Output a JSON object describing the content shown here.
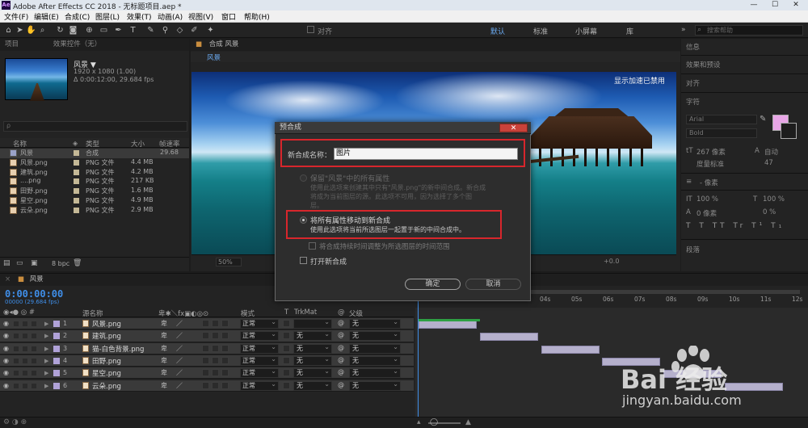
{
  "titlebar": {
    "logo": "Ae",
    "title": "Adobe After Effects CC 2018 - 无标题项目.aep *",
    "minimize": "—",
    "maximize": "☐",
    "close": "✕"
  },
  "menu": [
    "文件(F)",
    "编辑(E)",
    "合成(C)",
    "图层(L)",
    "效果(T)",
    "动画(A)",
    "视图(V)",
    "窗口",
    "帮助(H)"
  ],
  "toolbar": {
    "snap_label": "对齐",
    "workspaces": [
      "默认",
      "标准",
      "小屏幕",
      "库"
    ],
    "search_placeholder": "搜索帮助"
  },
  "project": {
    "tabs": [
      "项目",
      "效果控件（无）"
    ],
    "selected_name": "风景 ▼",
    "selected_info1": "1920 x 1080 (1.00)",
    "selected_info2": "Δ 0:00:12:00, 29.684 fps",
    "search_placeholder": "ρ",
    "columns": [
      "名称",
      "类型",
      "大小",
      "帧速率"
    ],
    "items": [
      {
        "name": "风景",
        "type": "合成",
        "size": "",
        "fps": "29.68",
        "comp": true
      },
      {
        "name": "风景.png",
        "type": "PNG 文件",
        "size": "4.4 MB",
        "fps": ""
      },
      {
        "name": "建筑.png",
        "type": "PNG 文件",
        "size": "4.2 MB",
        "fps": ""
      },
      {
        "name": "....png",
        "type": "PNG 文件",
        "size": "217 KB",
        "fps": ""
      },
      {
        "name": "田野.png",
        "type": "PNG 文件",
        "size": "1.6 MB",
        "fps": ""
      },
      {
        "name": "星空.png",
        "type": "PNG 文件",
        "size": "4.9 MB",
        "fps": ""
      },
      {
        "name": "云朵.png",
        "type": "PNG 文件",
        "size": "2.9 MB",
        "fps": ""
      }
    ],
    "bpc": "8 bpc"
  },
  "viewer": {
    "tab": "合成 风景",
    "subtab": "风景",
    "gpu_message": "显示加速已禁用",
    "zoom": "50%",
    "offset": "+0.0"
  },
  "right_panel": {
    "sections": [
      "信息",
      "效果和预设",
      "对齐",
      "字符"
    ],
    "font": "Arial",
    "style": "Bold",
    "size1": "267 像素",
    "auto": "自动",
    "metrics": "度量标准",
    "tracking": "47",
    "px": "- 像素",
    "scale_v": "100 %",
    "scale_h": "100 %",
    "baseline": "0 像素",
    "tsume": "0 %",
    "paragraph": "段落",
    "fill_color": "#e8a6e6"
  },
  "dialog": {
    "title": "预合成",
    "close": "✕",
    "name_label": "新合成名称：",
    "name_value": "图片",
    "opt1_title": "保留\"风景\"中的所有属性",
    "opt1_desc1": "使用此选项来创建其中只有\"风景.png\"的新中间合成。新合成",
    "opt1_desc2": "将成为当前图层的源。此选项不可用，因为选择了多个图",
    "opt1_desc3": "层。",
    "opt2_title": "将所有属性移动到新合成",
    "opt2_desc": "使用此选项将当前所选图层一起置于新的中间合成中。",
    "adjust_label": "将合成持续时间调整为所选图层的时间范围",
    "open_label": "打开新合成",
    "ok": "确定",
    "cancel": "取消"
  },
  "timeline": {
    "tab": "风景",
    "timecode": "0:00:00:00",
    "timecode_sub": "00000 (29.684 fps)",
    "col_name": "源名称",
    "col_mode": "模式",
    "col_t": "T",
    "col_trk": "TrkMat",
    "col_parent": "父级",
    "ticks": [
      "04s",
      "05s",
      "06s",
      "07s",
      "08s",
      "09s",
      "10s",
      "11s",
      "12s"
    ],
    "layers": [
      {
        "num": "1",
        "name": "风景.png",
        "mode": "正常",
        "trk": "",
        "parent": "无",
        "start": 0.0,
        "end": 0.154
      },
      {
        "num": "2",
        "name": "建筑.png",
        "mode": "正常",
        "trk": "无",
        "parent": "无",
        "start": 0.162,
        "end": 0.315
      },
      {
        "num": "3",
        "name": "猫-白色背景.png",
        "mode": "正常",
        "trk": "无",
        "parent": "无",
        "start": 0.323,
        "end": 0.476
      },
      {
        "num": "4",
        "name": "田野.png",
        "mode": "正常",
        "trk": "无",
        "parent": "无",
        "start": 0.484,
        "end": 0.637
      },
      {
        "num": "5",
        "name": "星空.png",
        "mode": "正常",
        "trk": "无",
        "parent": "无",
        "start": 0.645,
        "end": 0.798
      },
      {
        "num": "6",
        "name": "云朵.png",
        "mode": "正常",
        "trk": "无",
        "parent": "无",
        "start": 0.806,
        "end": 0.96
      }
    ]
  },
  "watermark": {
    "brand": "Bai 经验",
    "url": "jingyan.baidu.com"
  }
}
